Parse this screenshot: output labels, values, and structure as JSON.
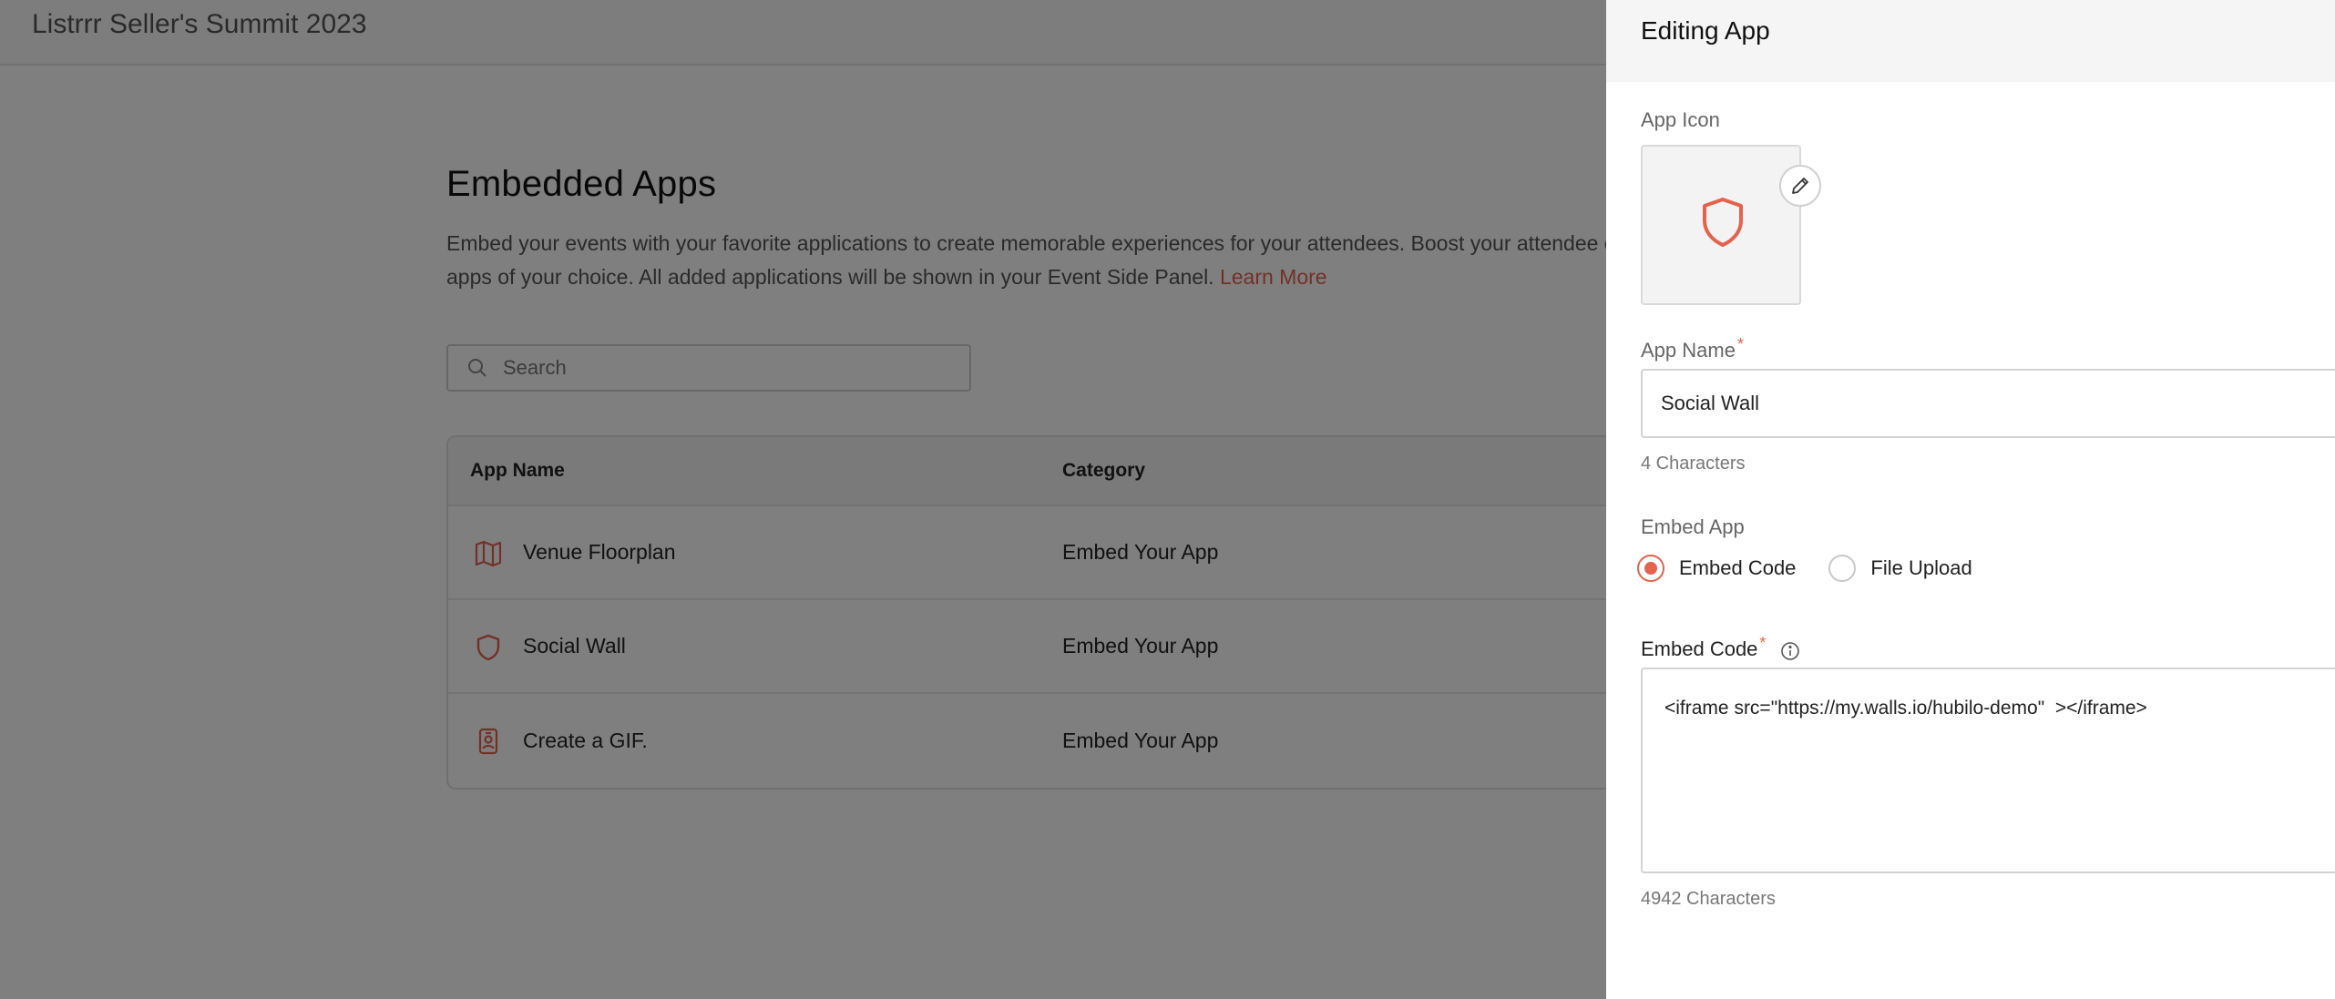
{
  "page": {
    "event_title": "Listrrr Seller's Summit 2023",
    "heading": "Embedded Apps",
    "description": "Embed your events with your favorite applications to create memorable experiences for your attendees. Boost your attendee en",
    "description_line2": "apps of your choice. All added applications will be shown in your Event Side Panel.",
    "learn_more": "Learn More",
    "search_placeholder": "Search",
    "table": {
      "headers": [
        "App Name",
        "Category"
      ],
      "rows": [
        {
          "icon": "map-icon",
          "name": "Venue Floorplan",
          "category": "Embed Your App"
        },
        {
          "icon": "shield-icon",
          "name": "Social Wall",
          "category": "Embed Your App"
        },
        {
          "icon": "badge-icon",
          "name": "Create a GIF.",
          "category": "Embed Your App"
        }
      ]
    }
  },
  "drawer": {
    "title": "Editing App",
    "app_icon_label": "App Icon",
    "app_icon": "shield-icon",
    "app_name_label": "App Name",
    "required_mark": "*",
    "app_name_value": "Social Wall",
    "app_name_count": "4 Characters",
    "embed_app_label": "Embed App",
    "embed_options": [
      "Embed Code",
      "File Upload"
    ],
    "embed_selected": "Embed Code",
    "embed_code_label": "Embed Code",
    "embed_code_value": "<iframe src=\"https://my.walls.io/hubilo-demo\"  ></iframe>",
    "embed_code_count": "4942 Characters"
  },
  "colors": {
    "accent": "#e4624e",
    "overlay": "rgba(0,0,0,0.5)",
    "header_bg": "#f5f5f5"
  }
}
